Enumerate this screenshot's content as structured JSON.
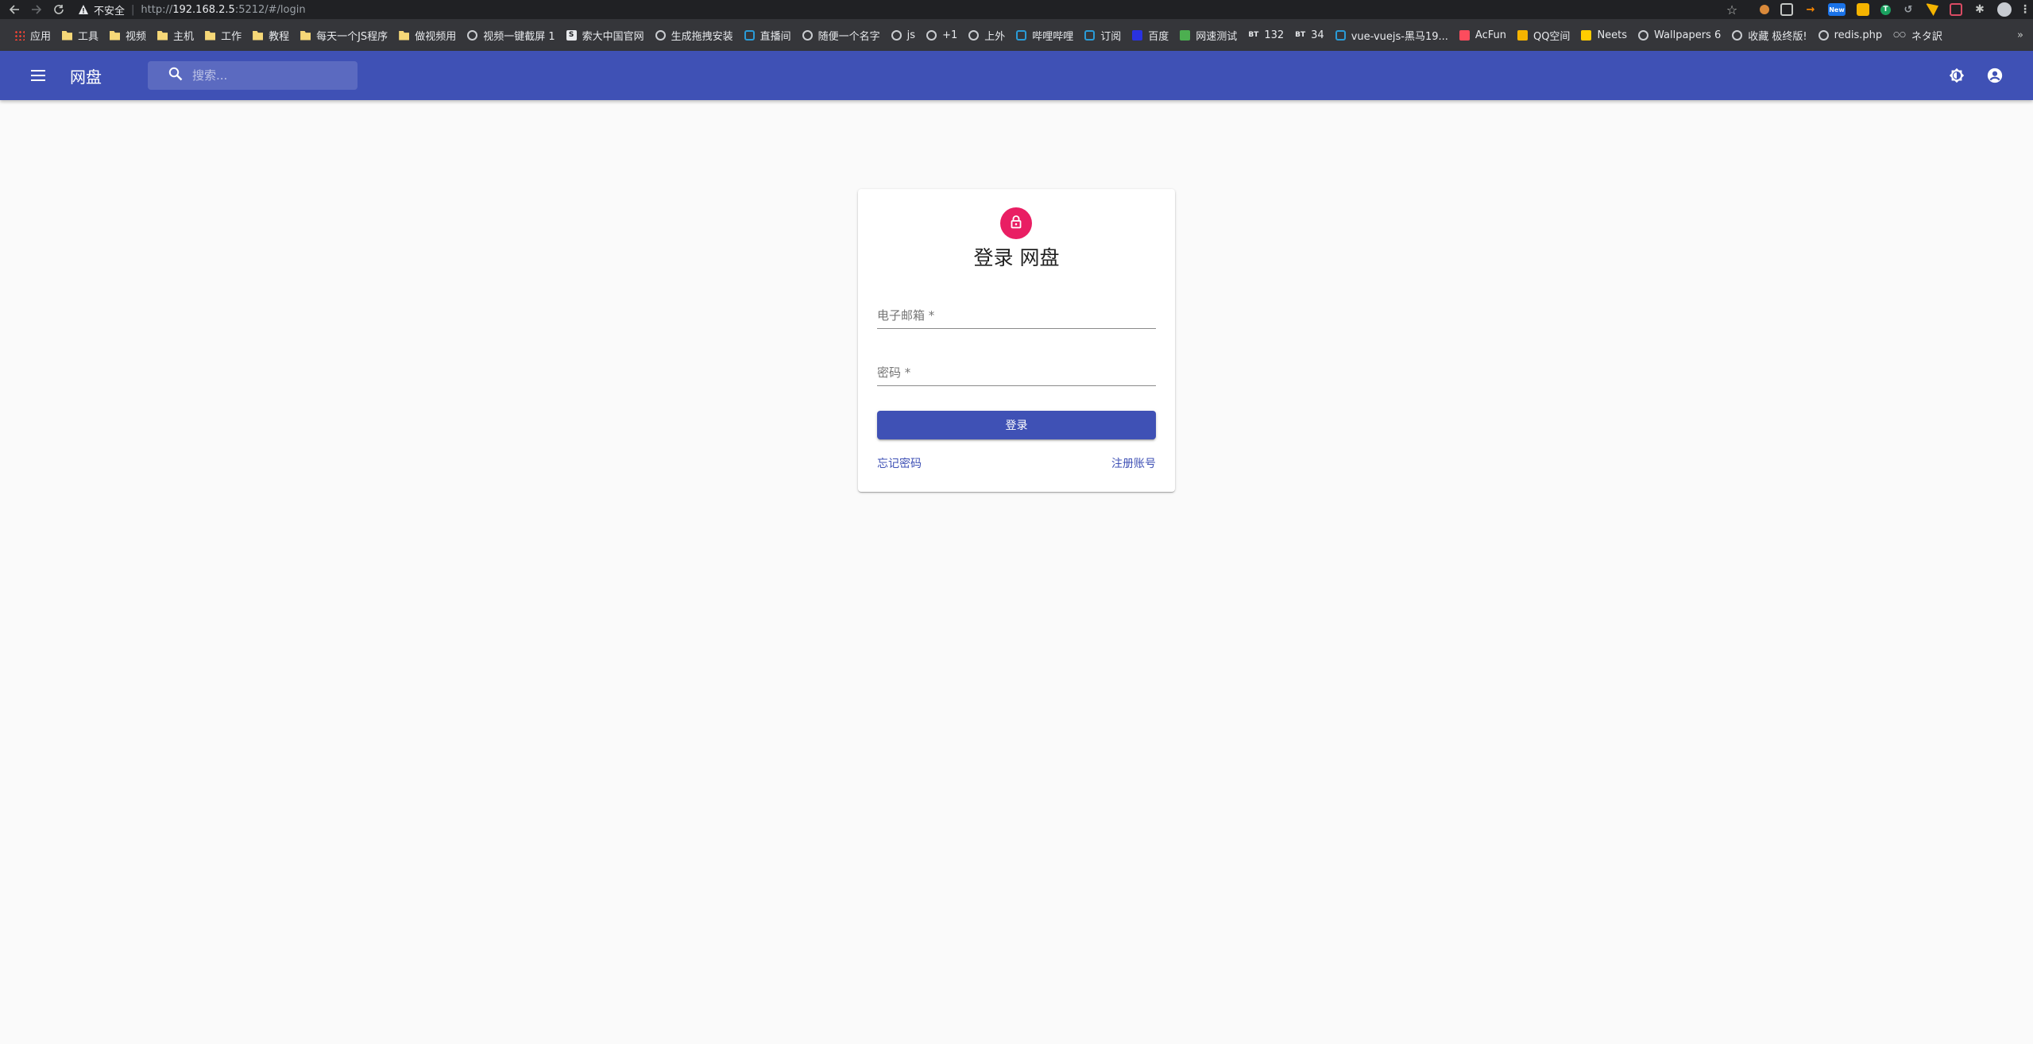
{
  "browser": {
    "security_label": "不安全",
    "url_scheme": "http://",
    "url_host": "192.168.2.5",
    "url_rest": ":5212/#/login",
    "extension_icons": [
      "cookie-icon",
      "game-icon",
      "arrow-icon",
      "new-badge-icon",
      "note-icon",
      "translate-icon",
      "history-icon",
      "chat-icon",
      "record-icon",
      "extensions-icon",
      "profile-avatar-icon",
      "more-menu-icon"
    ],
    "new_badge": "New"
  },
  "bookmarks": [
    {
      "label": "应用",
      "icon": "apps-icon"
    },
    {
      "label": "工具",
      "icon": "folder-icon"
    },
    {
      "label": "视频",
      "icon": "folder-icon"
    },
    {
      "label": "主机",
      "icon": "folder-icon"
    },
    {
      "label": "工作",
      "icon": "folder-icon"
    },
    {
      "label": "教程",
      "icon": "folder-icon"
    },
    {
      "label": "每天一个JS程序",
      "icon": "folder-icon"
    },
    {
      "label": "做视频用",
      "icon": "folder-icon"
    },
    {
      "label": "视频一键截屏 1",
      "icon": "globe-icon"
    },
    {
      "label": "索大中国官网",
      "icon": "s-icon"
    },
    {
      "label": "生成拖拽安装",
      "icon": "globe-icon"
    },
    {
      "label": "直播间",
      "icon": "tv-icon"
    },
    {
      "label": "随便一个名字",
      "icon": "globe-icon"
    },
    {
      "label": "js",
      "icon": "globe-icon"
    },
    {
      "label": "+1",
      "icon": "globe-icon"
    },
    {
      "label": "上外",
      "icon": "globe-icon"
    },
    {
      "label": "哔哩哔哩",
      "icon": "tv-icon"
    },
    {
      "label": "订阅",
      "icon": "tv-icon"
    },
    {
      "label": "百度",
      "icon": "baidu-icon"
    },
    {
      "label": "网速测试",
      "icon": "speed-icon"
    },
    {
      "label": "132",
      "icon": "bt-icon",
      "prefix": "BT"
    },
    {
      "label": "34",
      "icon": "bt-icon",
      "prefix": "BT"
    },
    {
      "label": "vue-vuejs-黑马19...",
      "icon": "tv-icon"
    },
    {
      "label": "AcFun",
      "icon": "acfun-icon"
    },
    {
      "label": "QQ空间",
      "icon": "star-icon"
    },
    {
      "label": "Neets",
      "icon": "neets-icon"
    },
    {
      "label": "Wallpapers 6",
      "icon": "globe-icon"
    },
    {
      "label": "收藏 极终版!",
      "icon": "globe-icon"
    },
    {
      "label": "redis.php",
      "icon": "globe-icon"
    },
    {
      "label": "ネタ訳",
      "icon": "neta-icon",
      "prefix": "○○"
    }
  ],
  "bookmarks_more": "»",
  "appbar": {
    "title": "网盘",
    "search_placeholder": "搜索...",
    "color": "#3f51b5"
  },
  "login": {
    "title": "登录 网盘",
    "email_label": "电子邮箱 *",
    "password_label": "密码 *",
    "submit_label": "登录",
    "forgot_label": "忘记密码",
    "register_label": "注册账号",
    "avatar_color": "#e91e63"
  }
}
